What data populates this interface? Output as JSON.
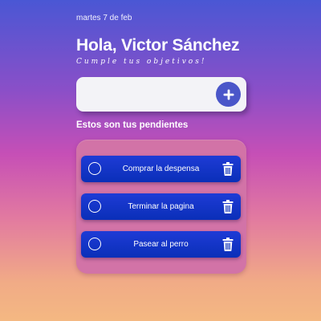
{
  "header": {
    "date": "martes 7 de feb",
    "greeting": "Hola, Victor Sánchez",
    "subtitle": "Cumple tus objetivos!"
  },
  "add_task": {
    "input_value": "",
    "button_icon": "plus-icon"
  },
  "tasks_section": {
    "title": "Estos son tus pendientes",
    "items": [
      {
        "label": "Comprar la despensa",
        "completed": false
      },
      {
        "label": "Terminar la pagina",
        "completed": false
      },
      {
        "label": "Pasear al perro",
        "completed": false
      }
    ]
  },
  "colors": {
    "accent": "#4a56c9",
    "task_bg": "#0a2fb8",
    "card_bg": "#d273a7"
  }
}
